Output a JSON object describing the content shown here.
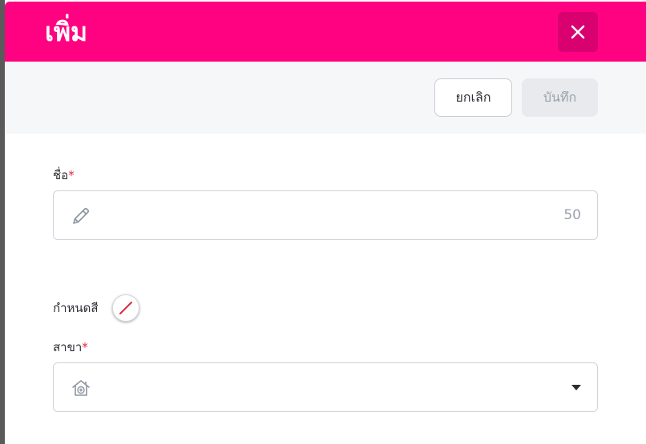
{
  "modal": {
    "title": "เพิ่ม",
    "close_icon": "close-icon"
  },
  "toolbar": {
    "cancel_label": "ยกเลิก",
    "save_label": "บันทึก"
  },
  "form": {
    "name": {
      "label": "ชื่อ",
      "required_mark": "*",
      "value": "",
      "counter": "50",
      "icon": "pencil-icon"
    },
    "color": {
      "label": "กำหนดสี",
      "icon": "no-color-swatch-icon"
    },
    "branch": {
      "label": "สาขา",
      "required_mark": "*",
      "value": "",
      "icon": "home-medical-icon",
      "dropdown_icon": "caret-down-icon"
    }
  },
  "colors": {
    "header_bg": "#ff0282",
    "close_btn_bg": "#d90070",
    "required": "#e0243a",
    "toolbar_bg": "#f6f7f9"
  }
}
